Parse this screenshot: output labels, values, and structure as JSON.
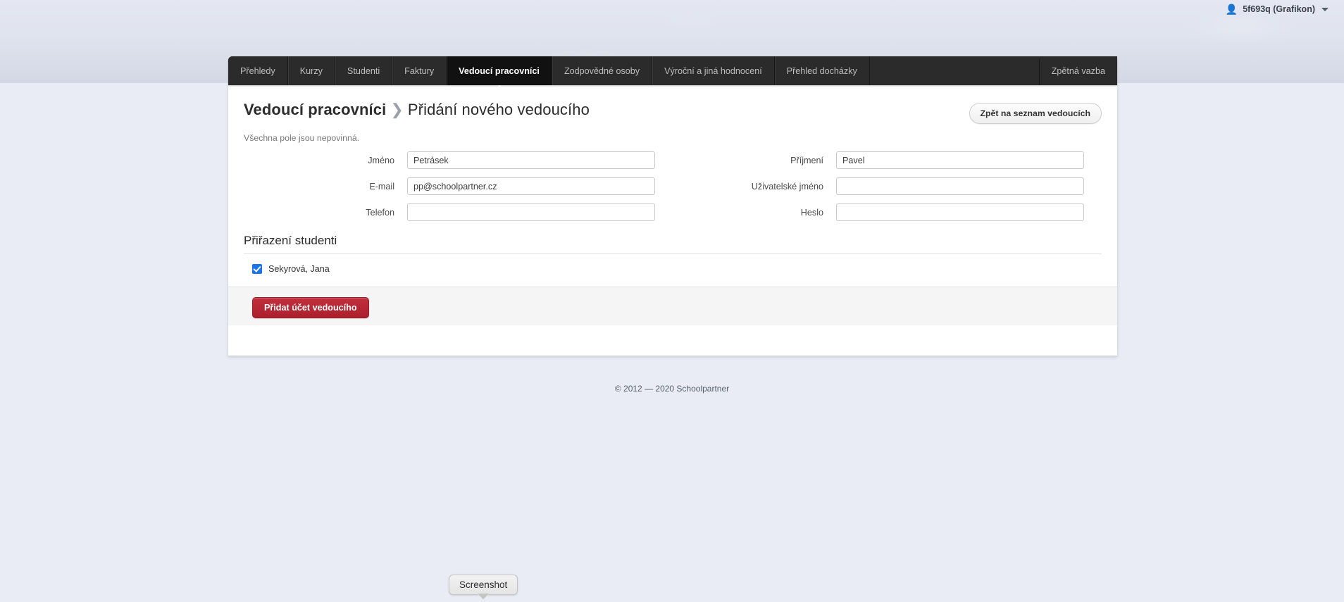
{
  "userbar": {
    "person_icon": "person-icon",
    "username": "5f693q (Grafikon)",
    "caret_icon": "chevron-down-icon"
  },
  "nav": {
    "items": [
      {
        "label": "Přehledy",
        "active": false
      },
      {
        "label": "Kurzy",
        "active": false
      },
      {
        "label": "Studenti",
        "active": false
      },
      {
        "label": "Faktury",
        "active": false
      },
      {
        "label": "Vedoucí pracovníci",
        "active": true
      },
      {
        "label": "Zodpovědné osoby",
        "active": false
      },
      {
        "label": "Výroční a jiná hodnocení",
        "active": false
      },
      {
        "label": "Přehled docházky",
        "active": false
      }
    ],
    "right_item": {
      "label": "Zpětná vazba"
    }
  },
  "page": {
    "breadcrumb_parent": "Vedoucí pracovníci",
    "breadcrumb_separator": "❯",
    "breadcrumb_current": "Přidání nového vedoucího",
    "back_button": "Zpět na seznam vedoucích",
    "hint": "Všechna pole jsou nepovinná."
  },
  "form": {
    "fields": [
      {
        "label": "Jméno",
        "value": "Petrásek",
        "placeholder": ""
      },
      {
        "label": "Příjmení",
        "value": "Pavel",
        "placeholder": ""
      },
      {
        "label": "E-mail",
        "value": "pp@schoolpartner.cz",
        "placeholder": ""
      },
      {
        "label": "Uživatelské jméno",
        "value": "",
        "placeholder": ""
      },
      {
        "label": "Telefon",
        "value": "",
        "placeholder": ""
      },
      {
        "label": "Heslo",
        "value": "",
        "placeholder": ""
      }
    ]
  },
  "students_section": {
    "title": "Přiřazení studenti",
    "students": [
      {
        "name": "Sekyrová, Jana",
        "checked": true
      }
    ]
  },
  "actions": {
    "submit_label": "Přidat účet vedoucího"
  },
  "footer": {
    "copyright": "© 2012 — 2020 Schoolpartner"
  },
  "tooltip": {
    "label": "Screenshot"
  },
  "colors": {
    "accent_red": "#b32430",
    "checkbox_blue": "#1b74e8",
    "nav_bg": "#2b2b2b",
    "nav_active_bg": "#111111",
    "page_bg": "#e9ecf4"
  }
}
